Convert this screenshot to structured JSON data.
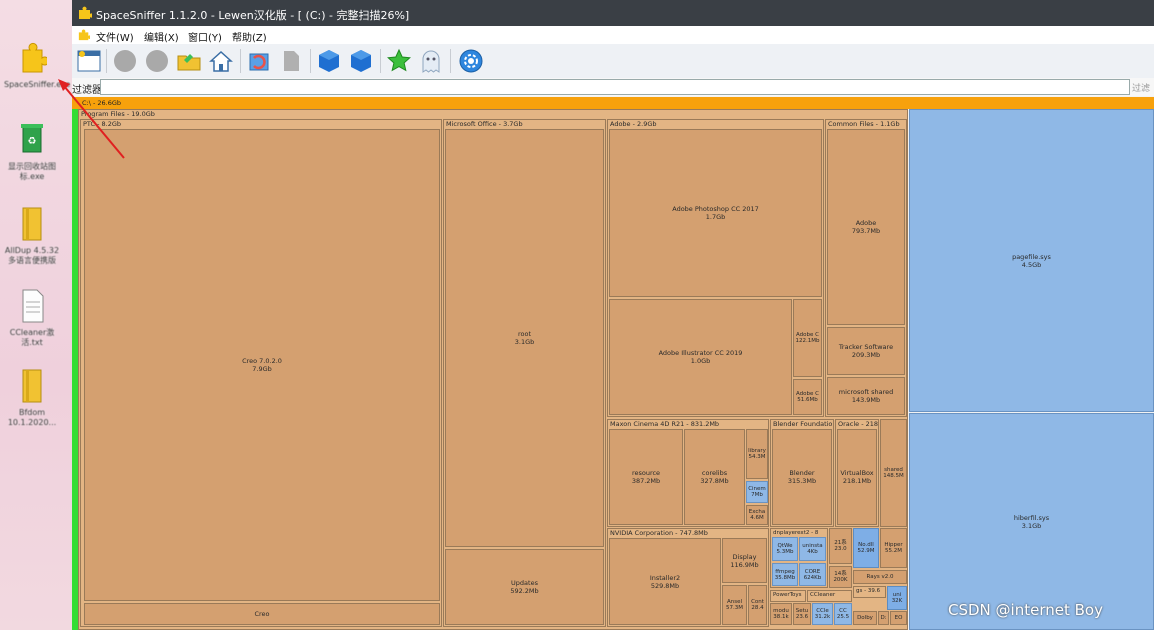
{
  "window": {
    "title": "SpaceSniffer 1.1.2.0 - Lewen汉化版 - [ (C:) - 完整扫描26%]"
  },
  "menu": [
    "文件(W)",
    "编辑(X)",
    "窗口(Y)",
    "帮助(Z)"
  ],
  "filter": {
    "label": "过滤器",
    "value": "",
    "go": "过滤"
  },
  "desktop_icons": [
    {
      "label": "SpaceSniffer.exe",
      "icon": "puzzle-icon"
    },
    {
      "label": "显示回收站图标.exe",
      "icon": "recycle-bin-icon"
    },
    {
      "label": "AllDup 4.5.32 多语言便携版",
      "icon": "folder-icon"
    },
    {
      "label": "CCleaner激活.txt",
      "icon": "text-file-icon"
    },
    {
      "label": "Bfdom 10.1.2020...",
      "icon": "folder-icon"
    }
  ],
  "treemap": {
    "root": "C:\\ - 26.6Gb",
    "program_files": "Program Files - 19.0Gb",
    "ptc": "PTC - 8.2Gb",
    "creo_block": {
      "name": "Creo 7.0.2.0",
      "size": "7.9Gb"
    },
    "creo_footer": "Creo",
    "ms_office": "Microsoft Office - 3.7Gb",
    "ms_root": {
      "name": "root",
      "size": "3.1Gb"
    },
    "ms_updates": {
      "name": "Updates",
      "size": "592.2Mb"
    },
    "adobe": "Adobe - 2.9Gb",
    "photoshop": {
      "name": "Adobe Photoshop CC 2017",
      "size": "1.7Gb"
    },
    "illustrator": {
      "name": "Adobe Illustrator CC 2019",
      "size": "1.0Gb"
    },
    "adobe_c1": {
      "name": "Adobe C",
      "size": "122.1Mb"
    },
    "adobe_c2": {
      "name": "Adobe C",
      "size": "51.6Mb"
    },
    "common_files": "Common Files - 1.1Gb",
    "cf_adobe": {
      "name": "Adobe",
      "size": "793.7Mb"
    },
    "tracker": {
      "name": "Tracker Software",
      "size": "209.3Mb"
    },
    "ms_shared": {
      "name": "microsoft shared",
      "size": "143.9Mb"
    },
    "maxon": "Maxon Cinema 4D R21 - 831.2Mb",
    "resource": {
      "name": "resource",
      "size": "387.2Mb"
    },
    "corelibs": {
      "name": "corelibs",
      "size": "327.8Mb"
    },
    "library": {
      "name": "library",
      "size": "54.3M"
    },
    "cinema": {
      "name": "Cinem",
      "size": "7Mb"
    },
    "exchange": {
      "name": "Excha",
      "size": "4.6M"
    },
    "blender": "Blender Foundatio",
    "blender_in": {
      "name": "Blender",
      "size": "315.3Mb"
    },
    "oracle": "Oracle - 218",
    "virtualbox": {
      "name": "VirtualBox",
      "size": "218.1Mb"
    },
    "shared": {
      "name": "shared",
      "size": "148.5M"
    },
    "nvidia": "NVIDIA Corporation - 747.8Mb",
    "installer2": {
      "name": "Installer2",
      "size": "529.8Mb"
    },
    "display": {
      "name": "Display",
      "size": "116.9Mb"
    },
    "ansel": {
      "name": "Ansel",
      "size": "57.3M"
    },
    "cont": {
      "name": "Cont",
      "size": "28.4"
    },
    "dnplayer": "dnplayerext2 - 8",
    "qtweb": {
      "name": "QtWe",
      "size": "5.3Mb"
    },
    "uninst": {
      "name": "uninsta",
      "size": "4Kb"
    },
    "ffmpeg": {
      "name": "ffmpeg",
      "size": "35.8Mb"
    },
    "core": {
      "name": "CORE",
      "size": "624Kb"
    },
    "small_214": {
      "name": "21系",
      "size": "23.0"
    },
    "small_14": {
      "name": "14系",
      "size": "200K"
    },
    "nodll": {
      "name": "No.dll",
      "size": "52.9M"
    },
    "hipp": {
      "name": "Hipper",
      "size": "55.2M"
    },
    "rays": "Rays v2.0",
    "gs": "gs - 39.6",
    "powertoys": "PowerToys",
    "ccleaner": "CCleaner",
    "modu": {
      "name": "modu",
      "size": "38.1k"
    },
    "setu": {
      "name": "Setu",
      "size": "23.6"
    },
    "ccle2": {
      "name": "CCle",
      "size": "31.2k"
    },
    "cc2": {
      "name": "CC",
      "size": "25.5"
    },
    "dolby": "Dolby",
    "dd": "D:",
    "eo": "EO",
    "uni": {
      "name": "uni",
      "size": "32K"
    },
    "pagefile": {
      "name": "pagefile.sys",
      "size": "4.5Gb"
    },
    "hiberfil": {
      "name": "hiberfil.sys",
      "size": "3.1Gb"
    }
  },
  "watermark": "CSDN @internet   Boy",
  "colors": {
    "folder": "#d4a070",
    "file": "#8fb8e6",
    "root_bar": "#f7a10c",
    "title_bar": "#3a3f45"
  }
}
